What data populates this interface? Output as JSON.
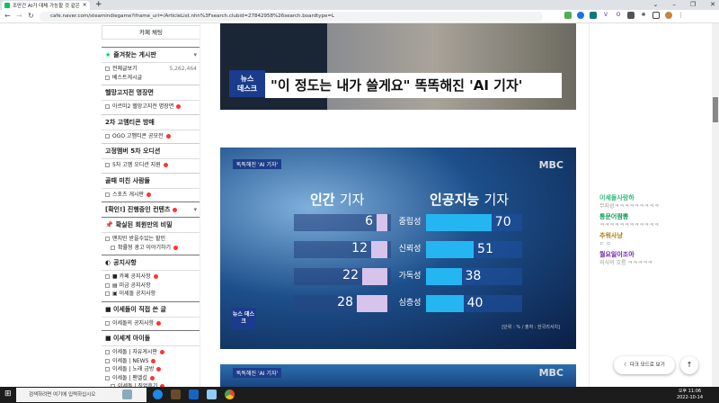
{
  "browser": {
    "tab_title": "조만간 AI가 대체 가능할 것 같은",
    "url": "cafe.naver.com/steamindiegame?iframe_url=/ArticleList.nhn%3Fsearch.clubid=27842958%26search.boardtype=L",
    "extensions": [
      "V",
      "O"
    ]
  },
  "sidebar": {
    "chat_button": "카페 채팅",
    "favorites_title": "즐겨찾는 게시판",
    "all_posts": "전체글보기",
    "all_count": "5,262,464",
    "best": "베스트게시글",
    "groups": [
      {
        "title": "헬망고지전 명장면",
        "items": [
          "아르미2 헬망고지전 명장면"
        ]
      },
      {
        "title": "2차 고멤티콘 방매",
        "items": [
          "OGO 고멤티콘 공모전"
        ]
      },
      {
        "title": "고정멤버 5차 오디션",
        "items": [
          "5차 고멤 오디션 지원"
        ]
      },
      {
        "title": "골때 미친 사람들",
        "items": [
          "스포츠 게시판"
        ]
      }
    ],
    "confirm": "[확인!] 진행중인 컨텐츠",
    "secret_title": "확실된 회원만의 비밀",
    "secret_items": [
      "맨치민 받을수있는 할인",
      "확률형 광고 이야기하기"
    ],
    "notice_title": "공지사항",
    "notice_items": [
      "■ 카페 공지사항",
      "▤ 미금 공지사항",
      "▣ 이세돌 공지사항"
    ],
    "isedol_title": "■ 이세돌이 직접 쓴 글",
    "isedol_items": [
      "이세돌의 공지사항"
    ],
    "idol_title": "■ 이세계 아이돌",
    "idol_items": [
      "이세돌 | 자유게시판",
      "이세돌 | NEWS",
      "이세돌 | 노래 금방",
      "이세돌 | 팬엘섭",
      "이세돌 | 직업후기"
    ]
  },
  "article": {
    "news_logo": "뉴스\n데스크",
    "headline": "\"이 정도는 내가 쓸게요\" 똑똑해진 'AI 기자'",
    "graphic": {
      "tag": "똑똑해진 'AI 기자'",
      "broadcaster": "MBC",
      "human_header_bold": "인간",
      "human_header": "기자",
      "ai_header_bold": "인공지능",
      "ai_header": "기자",
      "rows": [
        {
          "label": "중립성",
          "human": 6,
          "ai": 70
        },
        {
          "label": "신뢰성",
          "human": 12,
          "ai": 51
        },
        {
          "label": "가독성",
          "human": 22,
          "ai": 38
        },
        {
          "label": "심층성",
          "human": 28,
          "ai": 40
        }
      ],
      "source": "[단위 : % / 출처 : 한국리서치]"
    },
    "graphic2_tag": "똑똑해진 'AI 기자'"
  },
  "chat": [
    {
      "name": "이세돌사랑하",
      "msg": "무지성ㅋㅋㅋㅋㅋㅋㅋㅋㅋ",
      "color": "#2db87a"
    },
    {
      "name": "통문어짬뽕",
      "msg": "ㅋㅋㅋㅋㅋㅋㅋㅋㅋㅋㅋㅋ",
      "color": "#13a05a"
    },
    {
      "name": "추워사냥",
      "msg": "ㄷ ㅇ",
      "color": "#b07a00"
    },
    {
      "name": "월요일이조아",
      "msg": "의식의 흐름 ㅋㅋㅋㅋㅋ",
      "color": "#6a1fb0"
    }
  ],
  "floating": {
    "dark_mode": "다크 모드로 보기",
    "top": "↑"
  },
  "taskbar": {
    "search_placeholder": "검색하려면 여기에 입력하십시오",
    "time": "오후 11:06",
    "date": "2022-10-14"
  }
}
